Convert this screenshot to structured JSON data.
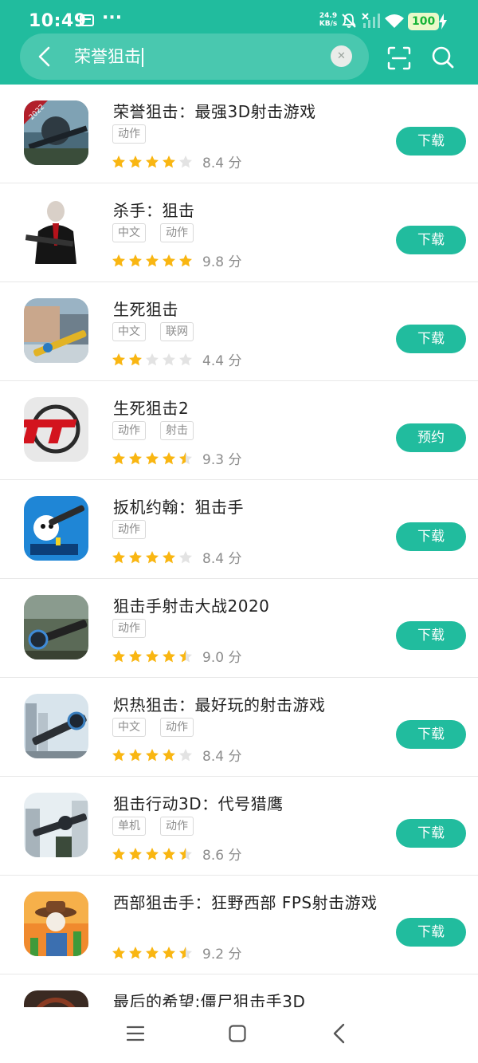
{
  "status_bar": {
    "time": "10:49",
    "net_speed_value": "24.9",
    "net_speed_unit": "KB/s",
    "battery": "100"
  },
  "search": {
    "query": "荣誉狙击"
  },
  "colors": {
    "brand": "#21bc9e",
    "star_filled": "#f9b612",
    "star_empty": "#e3e3e3"
  },
  "apps": [
    {
      "title": "荣誉狙击：最强3D射击游戏",
      "tags": [
        "动作"
      ],
      "stars": 4,
      "score": "8.4 分",
      "action": "下载",
      "icon": "sniper-soldier-2022-icon"
    },
    {
      "title": "杀手：狙击",
      "tags": [
        "中文",
        "动作"
      ],
      "stars": 5,
      "score": "9.8 分",
      "action": "下载",
      "icon": "hitman-agent-icon"
    },
    {
      "title": "生死狙击",
      "tags": [
        "中文",
        "联网"
      ],
      "stars": 2,
      "score": "4.4 分",
      "action": "下载",
      "icon": "gold-rifle-icon"
    },
    {
      "title": "生死狙击2",
      "tags": [
        "动作",
        "射击"
      ],
      "stars": 4.5,
      "score": "9.3 分",
      "action": "预约",
      "icon": "sc-logo-icon"
    },
    {
      "title": "扳机约翰：狙击手",
      "tags": [
        "动作"
      ],
      "stars": 4,
      "score": "8.4 分",
      "action": "下载",
      "icon": "cartoon-sniper-icon"
    },
    {
      "title": "狙击手射击大战2020",
      "tags": [
        "动作"
      ],
      "stars": 4.5,
      "score": "9.0 分",
      "action": "下载",
      "icon": "scope-rifle-icon"
    },
    {
      "title": "炽热狙击：最好玩的射击游戏",
      "tags": [
        "中文",
        "动作"
      ],
      "stars": 4,
      "score": "8.4 分",
      "action": "下载",
      "icon": "city-sniper-icon"
    },
    {
      "title": "狙击行动3D：代号猎鹰",
      "tags": [
        "单机",
        "动作"
      ],
      "stars": 4.5,
      "score": "8.6 分",
      "action": "下载",
      "icon": "rooftop-sniper-icon"
    },
    {
      "title": "西部狙击手：狂野西部 FPS射击游戏",
      "tags": [],
      "stars": 4.5,
      "score": "9.2 分",
      "action": "下载",
      "icon": "cowboy-icon"
    }
  ],
  "partial_app": {
    "title": "最后的希望:僵尸狙击手3D"
  }
}
